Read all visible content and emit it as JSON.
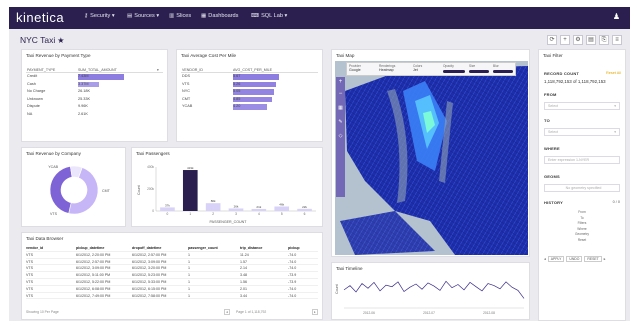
{
  "app": {
    "brand": "kinetica",
    "nav": [
      {
        "label": "Security ▾",
        "icon": "⚷"
      },
      {
        "label": "Sources ▾",
        "icon": "▤"
      },
      {
        "label": "Slices",
        "icon": "▥"
      },
      {
        "label": "Dashboards",
        "icon": "▦"
      },
      {
        "label": "SQL Lab ▾",
        "icon": "⌨"
      }
    ],
    "user_icon": "♟"
  },
  "page": {
    "title": "NYC Taxi",
    "star": "★",
    "buttons": [
      "⟳",
      "+",
      "⚙",
      "▤",
      "⎘",
      "≡"
    ]
  },
  "payment_card": {
    "title": "Taxi Revenue by Payment Type",
    "col1": "PAYMENT_TYPE",
    "col2": "SUM_TOTAL_AMOUNT",
    "rows": [
      {
        "label": "Credit",
        "value": "7.43M",
        "fraction": 1.0
      },
      {
        "label": "Cash",
        "value": "3.37M",
        "fraction": 0.45
      },
      {
        "label": "No Charge",
        "value": "26.18K",
        "fraction": 0
      },
      {
        "label": "Unknown",
        "value": "25.33K",
        "fraction": 0
      },
      {
        "label": "Dispute",
        "value": "9.96K",
        "fraction": 0
      },
      {
        "label": "NA",
        "value": "2.61K",
        "fraction": 0
      }
    ]
  },
  "cost_card": {
    "title": "Taxi Average Cost Per Mile",
    "col1": "VENDOR_ID",
    "col2": "AVG_COST_PER_MILE",
    "rows": [
      {
        "label": "DDS",
        "value": "5.67",
        "fraction": 1.0
      },
      {
        "label": "VTS",
        "value": "5.26",
        "fraction": 0.93
      },
      {
        "label": "NYC",
        "value": "5.05",
        "fraction": 0.89
      },
      {
        "label": "CMT",
        "value": "4.85",
        "fraction": 0.85
      },
      {
        "label": "YCAB",
        "value": "4.20",
        "fraction": 0.74
      }
    ]
  },
  "company_card": {
    "title": "Taxi Revenue by Company",
    "labels": [
      "YCAB",
      "CMT",
      "VTS"
    ]
  },
  "passengers_card": {
    "title": "Taxi Passengers",
    "ylabel": "Count",
    "xlabel": "PASSENGER_COUNT",
    "y_ticks": [
      "400k",
      "200k",
      "0"
    ]
  },
  "map_card": {
    "title": "Taxi Map",
    "controls": [
      {
        "label": "Provider",
        "value": "Google"
      },
      {
        "label": "Renderings",
        "value": "Heatmap"
      },
      {
        "label": "Colors",
        "value": "Jet"
      },
      {
        "label": "Opacity",
        "value": ""
      },
      {
        "label": "Size",
        "value": ""
      },
      {
        "label": "Blur",
        "value": ""
      }
    ]
  },
  "filter_card": {
    "title": "Taxi Filter",
    "record_count_label": "RECORD COUNT",
    "reset_label": "Reset All",
    "record_count_value": "1,118,792,153 of 1,118,792,153",
    "from_label": "FROM",
    "from_placeholder": "Select",
    "to_label": "TO",
    "to_placeholder": "Select",
    "where_label": "WHERE",
    "where_placeholder": "Enter expression 1-NYER",
    "geoms_label": "GEOMS",
    "geoms_placeholder": "No geometry specified",
    "history_label": "HISTORY",
    "history_count": "0 / 0",
    "history_items": [
      "From",
      "To",
      "Filters",
      "Where",
      "Geometry",
      "Reset"
    ],
    "pager": [
      "APPLY",
      "UNDO",
      "RESET"
    ]
  },
  "browser_card": {
    "title": "Taxi Data Browser",
    "columns": [
      "vendor_id",
      "pickup_datetime",
      "dropoff_datetime",
      "passenger_count",
      "trip_distance",
      "pickup"
    ],
    "rows": [
      [
        "VTS",
        "6/1/2012, 2:20:00 PM",
        "6/1/2012, 2:57:00 PM",
        "1",
        "11.24",
        "-74.0"
      ],
      [
        "VTS",
        "6/1/2012, 2:57:00 PM",
        "6/1/2012, 3:09:00 PM",
        "1",
        "1.57",
        "-74.0"
      ],
      [
        "VTS",
        "6/1/2012, 3:09:00 PM",
        "6/1/2012, 3:20:00 PM",
        "1",
        "2.14",
        "-74.0"
      ],
      [
        "VTS",
        "6/1/2012, 5:11:00 PM",
        "6/1/2012, 5:23:00 PM",
        "1",
        "3.48",
        "-73.9"
      ],
      [
        "VTS",
        "6/1/2012, 5:22:00 PM",
        "6/1/2012, 5:33:00 PM",
        "1",
        "1.56",
        "-73.9"
      ],
      [
        "VTS",
        "6/1/2012, 6:08:00 PM",
        "6/1/2012, 6:15:00 PM",
        "1",
        "2.01",
        "-74.0"
      ],
      [
        "VTS",
        "6/1/2012, 7:49:00 PM",
        "6/1/2012, 7:58:00 PM",
        "1",
        "3.44",
        "-74.0"
      ]
    ],
    "footer_left": "Showing 10 Per Page",
    "footer_page": "Page 1 of 1,118,792"
  },
  "timeline_card": {
    "title": "Taxi Timeline",
    "ylabel": "Count",
    "x_ticks": [
      "2012-06",
      "2012-07",
      "2012-08"
    ]
  },
  "chart_data": [
    {
      "type": "bar",
      "title": "Taxi Revenue by Payment Type",
      "categories": [
        "Credit",
        "Cash",
        "No Charge",
        "Unknown",
        "Dispute",
        "NA"
      ],
      "series": [
        {
          "name": "SUM_TOTAL_AMOUNT",
          "values": [
            7430000,
            3370000,
            26180,
            25330,
            9960,
            2610
          ]
        }
      ]
    },
    {
      "type": "bar",
      "title": "Taxi Average Cost Per Mile",
      "categories": [
        "DDS",
        "VTS",
        "NYC",
        "CMT",
        "YCAB"
      ],
      "series": [
        {
          "name": "AVG_COST_PER_MILE",
          "values": [
            5.67,
            5.26,
            5.05,
            4.85,
            4.2
          ]
        }
      ]
    },
    {
      "type": "pie",
      "title": "Taxi Revenue by Company",
      "categories": [
        "CMT",
        "VTS",
        "YCAB"
      ],
      "values": [
        48,
        44,
        8
      ],
      "colors": [
        "#c6b6f7",
        "#7d63d6",
        "#ece6fd"
      ]
    },
    {
      "type": "bar",
      "title": "Taxi Passengers",
      "xlabel": "PASSENGER_COUNT",
      "ylabel": "Count",
      "categories": [
        "0",
        "1",
        "2",
        "3",
        "4",
        "5",
        "6"
      ],
      "values": [
        37000,
        419000,
        80000,
        26000,
        21000,
        46000,
        22000
      ],
      "data_labels": [
        "37k",
        "419k",
        "80k",
        "26k",
        "21k",
        "46k",
        "22k"
      ],
      "ylim": [
        0,
        450000
      ]
    },
    {
      "type": "line",
      "title": "Taxi Timeline",
      "ylabel": "Count",
      "x": [
        "2012-06-01",
        "2012-06-04",
        "2012-06-07",
        "2012-06-10",
        "2012-06-13",
        "2012-06-16",
        "2012-06-19",
        "2012-06-22",
        "2012-06-25",
        "2012-06-28",
        "2012-07-01",
        "2012-07-04",
        "2012-07-07",
        "2012-07-10",
        "2012-07-13",
        "2012-07-16",
        "2012-07-19",
        "2012-07-22",
        "2012-07-25",
        "2012-07-28",
        "2012-07-31",
        "2012-08-03",
        "2012-08-06",
        "2012-08-09",
        "2012-08-12",
        "2012-08-15",
        "2012-08-18",
        "2012-08-21",
        "2012-08-24",
        "2012-08-27",
        "2012-08-30"
      ],
      "values": [
        170,
        210,
        150,
        230,
        185,
        240,
        160,
        215,
        200,
        245,
        155,
        195,
        225,
        175,
        235,
        205,
        165,
        250,
        190,
        220,
        170,
        240,
        200,
        160,
        230,
        210,
        180,
        245,
        195,
        165,
        90
      ],
      "ylim": [
        0,
        300
      ]
    }
  ]
}
